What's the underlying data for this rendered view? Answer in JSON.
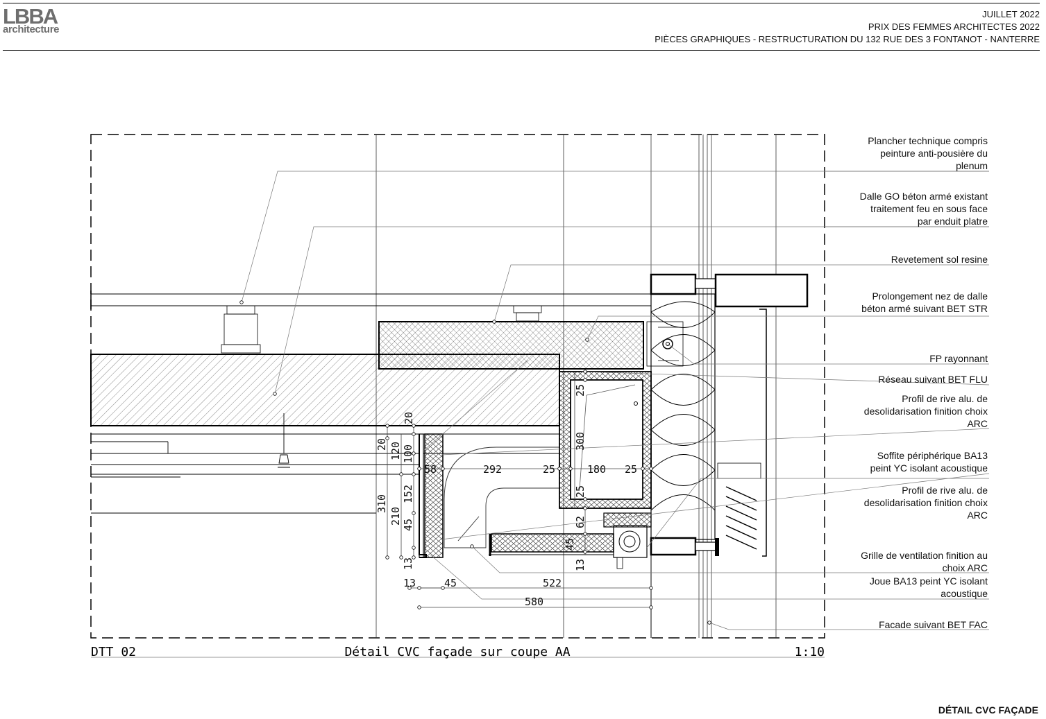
{
  "header": {
    "logo_main": "LBBA",
    "logo_sub": "architecture",
    "line1": "JUILLET 2022",
    "line2": "PRIX DES FEMMES ARCHITECTES 2022",
    "line3": "PIÈCES GRAPHIQUES - RESTRUCTURATION DU 132 RUE DES 3 FONTANOT - NANTERRE"
  },
  "footer": {
    "page_title": "DÉTAIL CVC FAÇADE"
  },
  "drawing": {
    "ref": "DTT 02",
    "title": "Détail CVC façade sur coupe AA",
    "scale": "1:10",
    "annotations": [
      [
        "Plancher technique compris",
        "peinture anti-pousière du",
        "plenum"
      ],
      [
        "Dalle GO béton armé existant",
        "traitement feu en sous face",
        "par enduit platre"
      ],
      [
        "Revetement sol resine"
      ],
      [
        "Prolongement nez de dalle",
        "béton armé suivant BET STR"
      ],
      [
        "FP rayonnant"
      ],
      [
        "Réseau suivant BET FLU"
      ],
      [
        "Profil de rive alu. de",
        "desolidarisation finition choix",
        "ARC"
      ],
      [
        "Soffite périphérique BA13",
        "peint YC isolant acoustique"
      ],
      [
        "Profil de rive alu. de",
        "desolidarisation finition choix",
        "ARC"
      ],
      [
        "Grille de ventilation finition au",
        "choix ARC"
      ],
      [
        "Joue BA13 peint YC isolant",
        "acoustique"
      ],
      [
        "Facade suivant BET FAC"
      ]
    ],
    "dimensions": {
      "v20a": "20",
      "v20b": "20",
      "v120": "120",
      "v100": "100",
      "v310": "310",
      "v210": "210",
      "v152": "152",
      "v45a": "45",
      "v13a": "13",
      "v25a": "25",
      "v300": "300",
      "v25b": "25",
      "v62": "62",
      "v45b": "45",
      "v13b": "13",
      "h58": "58",
      "h292": "292",
      "h25a": "25",
      "h180": "180",
      "h25b": "25",
      "h13": "13",
      "h45": "45",
      "h522": "522",
      "h580": "580"
    }
  }
}
